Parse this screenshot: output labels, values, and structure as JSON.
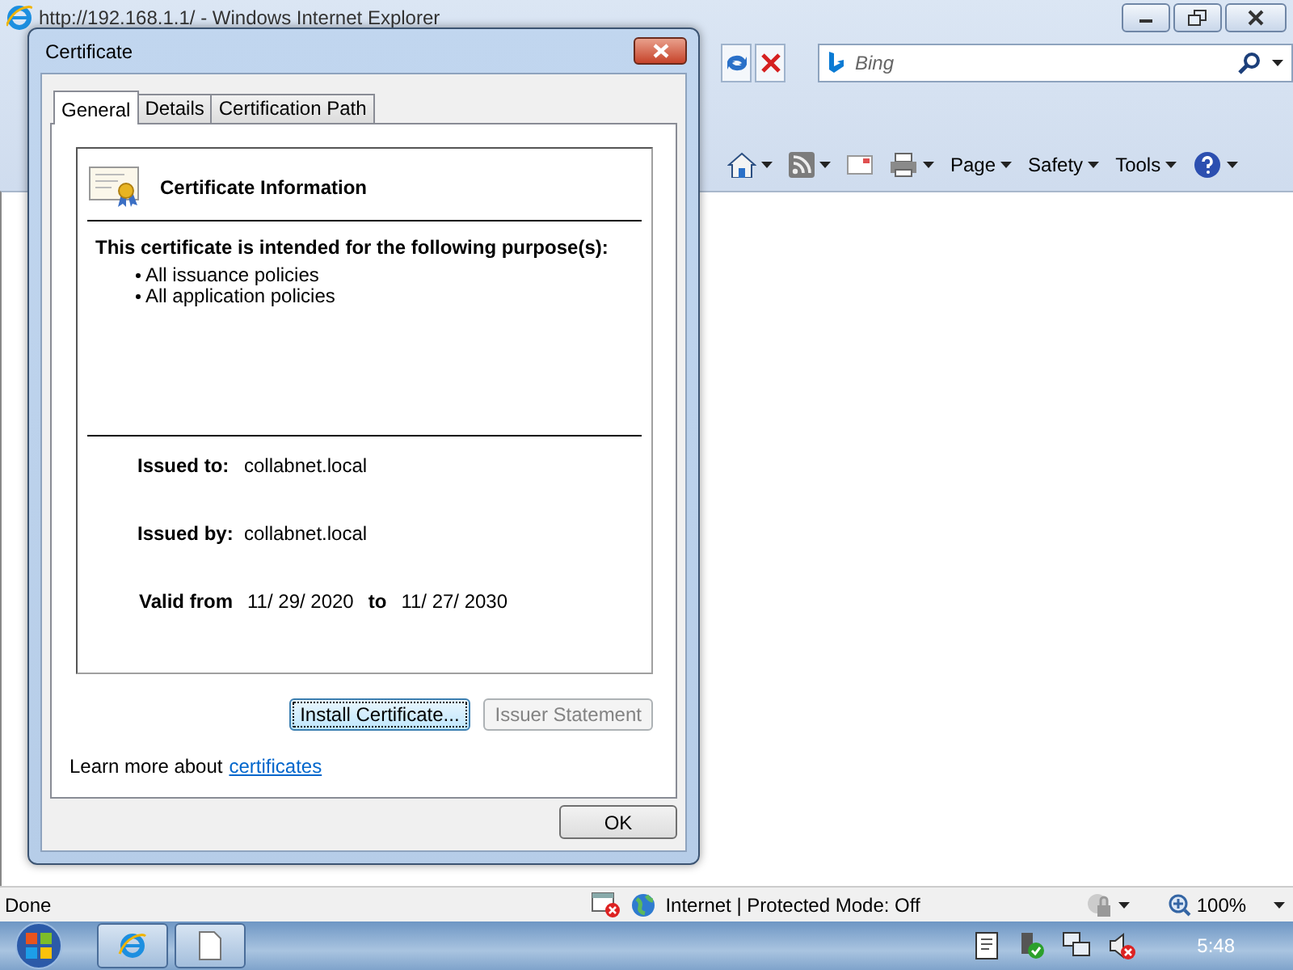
{
  "browser": {
    "title": "http://192.168.1.1/ - Windows Internet Explorer",
    "search": {
      "placeholder": "Bing"
    },
    "command_bar": [
      {
        "label": "Page"
      },
      {
        "label": "Safety"
      },
      {
        "label": "Tools"
      }
    ],
    "status_bar": {
      "status": "Done",
      "zone": "Internet | Protected Mode: Off",
      "zoom": "100%"
    }
  },
  "dialog": {
    "title": "Certificate",
    "tabs": [
      {
        "label": "General",
        "selected": true
      },
      {
        "label": "Details",
        "selected": false
      },
      {
        "label": "Certification Path",
        "selected": false
      }
    ],
    "heading": "Certificate Information",
    "purpose_title": "This certificate is intended for the following purpose(s):",
    "purposes": [
      "All issuance policies",
      "All application policies"
    ],
    "fields": [
      {
        "label": "Issued to:",
        "value": "collabnet.local"
      },
      {
        "label": "Issued by:",
        "value": "collabnet.local"
      }
    ],
    "validity": {
      "from_label": "Valid from",
      "from": "11/ 29/ 2020",
      "to_label": "to",
      "to": "11/ 27/ 2030"
    },
    "buttons": [
      {
        "label": "Install Certificate...",
        "disabled": false
      },
      {
        "label": "Issuer Statement",
        "disabled": true
      }
    ],
    "learn_more": "Learn more about",
    "learn_more_link": "certificates",
    "ok": "OK"
  },
  "taskbar": {
    "clock": "5:48"
  }
}
